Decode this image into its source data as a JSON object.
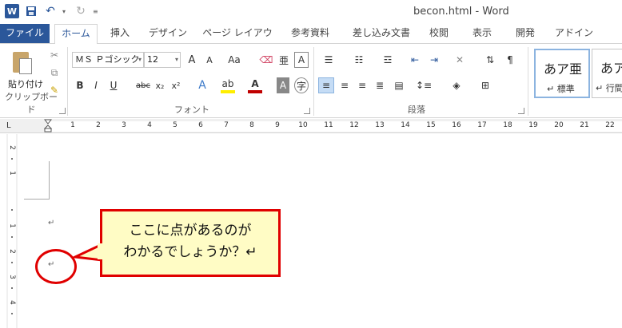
{
  "title_bar": {
    "app_icon_letter": "W",
    "title": "becon.html - Word",
    "save_icon": "save-icon",
    "undo_icon": "undo-icon",
    "redo_icon": "redo-icon"
  },
  "tabs": [
    {
      "label": "ファイル"
    },
    {
      "label": "ホーム"
    },
    {
      "label": "挿入"
    },
    {
      "label": "デザイン"
    },
    {
      "label": "ページ レイアウト"
    },
    {
      "label": "参考資料"
    },
    {
      "label": "差し込み文書"
    },
    {
      "label": "校閲"
    },
    {
      "label": "表示"
    },
    {
      "label": "開発"
    },
    {
      "label": "アドイン"
    }
  ],
  "ribbon": {
    "clipboard": {
      "paste_label": "貼り付け",
      "group_label": "クリップボード"
    },
    "font": {
      "font_name": "ＭＳ Ｐゴシック",
      "font_size": "12",
      "group_label": "フォント",
      "bold": "B",
      "italic": "I",
      "underline": "U",
      "strike": "abc",
      "subscript": "x₂",
      "superscript": "x²",
      "grow": "A",
      "shrink": "A",
      "case": "Aa"
    },
    "paragraph": {
      "group_label": "段落"
    },
    "styles": [
      {
        "sample": "あア亜",
        "name": "↵ 標準"
      },
      {
        "sample": "あア",
        "name": "↵ 行間"
      }
    ]
  },
  "ruler": {
    "tab_selector": "L",
    "numbers": [
      "1",
      "2",
      "3",
      "4",
      "5",
      "6",
      "7",
      "8",
      "9",
      "10",
      "11",
      "12",
      "13",
      "14",
      "15",
      "16",
      "17",
      "18",
      "19",
      "20",
      "21",
      "22"
    ]
  },
  "vruler": {
    "numbers": [
      "2",
      "1",
      "1",
      "2",
      "3",
      "4"
    ]
  },
  "document": {
    "paragraph_mark_1": "↵",
    "paragraph_mark_2": "↵"
  },
  "callout": {
    "line1": "ここに点があるのが",
    "line2": "わかるでしょうか？↵"
  },
  "colors": {
    "accent": "#2b579a",
    "callout_border": "#e00000",
    "callout_fill": "#fffcc5"
  }
}
